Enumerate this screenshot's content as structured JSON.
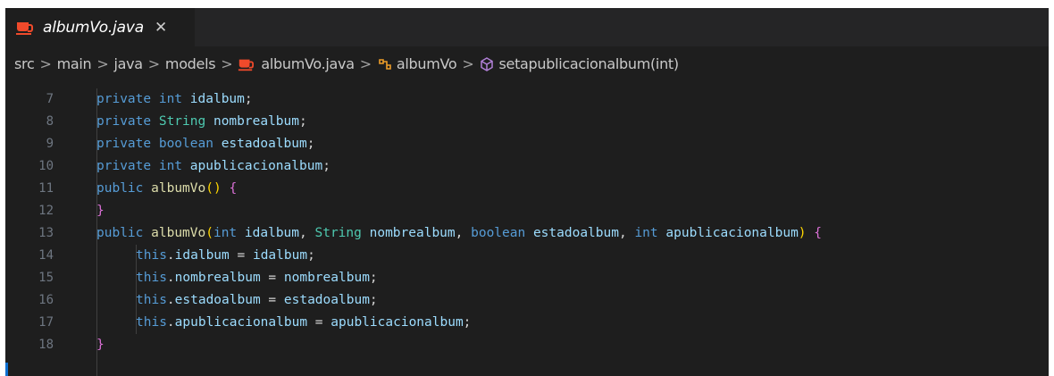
{
  "tab": {
    "icon": "java-file-icon",
    "label": "albumVo.java",
    "close_glyph": "✕"
  },
  "breadcrumb": {
    "items": [
      "src",
      "main",
      "java",
      "models",
      "albumVo.java",
      "albumVo",
      "setapublicacionalbum(int)"
    ],
    "separator": ">"
  },
  "editor": {
    "line_numbers": [
      "7",
      "8",
      "9",
      "10",
      "11",
      "12",
      "13",
      "14",
      "15",
      "16",
      "17",
      "18"
    ],
    "lines": [
      "private int idalbum;",
      "private String nombrealbum;",
      "private boolean estadoalbum;",
      "private int apublicacionalbum;",
      "public albumVo() {",
      "}",
      "public albumVo(int idalbum, String nombrealbum, boolean estadoalbum, int apublicacionalbum) {",
      "this.idalbum = idalbum;",
      "this.nombrealbum = nombrealbum;",
      "this.estadoalbum = estadoalbum;",
      "this.apublicacionalbum = apublicacionalbum;",
      "}"
    ]
  },
  "colors": {
    "background": "#1e1e1e",
    "keyword": "#569cd6",
    "type": "#4ec9b0",
    "identifier": "#9cdcfe",
    "function": "#dcdcaa",
    "java_icon": "#f04a2b"
  }
}
